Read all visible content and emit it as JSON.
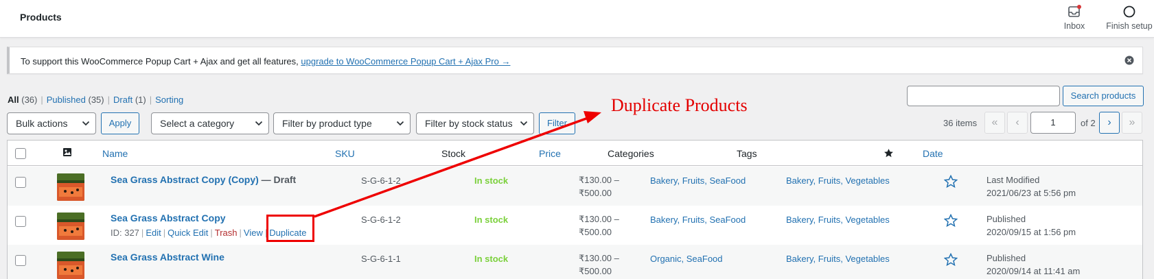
{
  "header": {
    "title": "Products",
    "inbox_label": "Inbox",
    "finish_label": "Finish setup"
  },
  "notice": {
    "text": "To support this WooCommerce Popup Cart + Ajax and get all features, ",
    "link": "upgrade to WooCommerce Popup Cart + Ajax Pro →"
  },
  "views": [
    {
      "label": "All",
      "count": "(36)"
    },
    {
      "label": "Published",
      "count": "(35)"
    },
    {
      "label": "Draft",
      "count": "(1)"
    },
    {
      "label": "Sorting",
      "count": ""
    }
  ],
  "search": {
    "button": "Search products",
    "value": ""
  },
  "filters": {
    "bulk": "Bulk actions",
    "apply": "Apply",
    "category": "Select a category",
    "type": "Filter by product type",
    "stock": "Filter by stock status",
    "filter": "Filter"
  },
  "pagination": {
    "items": "36 items",
    "first": "«",
    "prev": "‹",
    "current": "1",
    "of": "of 2",
    "next": "›",
    "last": "»"
  },
  "columns": {
    "name": "Name",
    "sku": "SKU",
    "stock": "Stock",
    "price": "Price",
    "categories": "Categories",
    "tags": "Tags",
    "date": "Date"
  },
  "rows": [
    {
      "name": "Sea Grass Abstract Copy (Copy)",
      "state": " — Draft",
      "sku": "S-G-6-1-2",
      "stock": "In stock",
      "price_low": "₹130.00 –",
      "price_high": "₹500.00",
      "categories": "Bakery, Fruits, SeaFood",
      "tags": "Bakery, Fruits, Vegetables",
      "date_status": "Last Modified",
      "date_value": "2021/06/23 at 5:56 pm"
    },
    {
      "name": "Sea Grass Abstract Copy",
      "state": "",
      "sku": "S-G-6-1-2",
      "stock": "In stock",
      "price_low": "₹130.00 –",
      "price_high": "₹500.00",
      "categories": "Bakery, Fruits, SeaFood",
      "tags": "Bakery, Fruits, Vegetables",
      "date_status": "Published",
      "date_value": "2020/09/15 at 1:56 pm",
      "actions": {
        "id": "ID: 327",
        "edit": "Edit",
        "quick_edit": "Quick Edit",
        "trash": "Trash",
        "view": "View",
        "duplicate": "Duplicate"
      }
    },
    {
      "name": "Sea Grass Abstract Wine",
      "state": "",
      "sku": "S-G-6-1-1",
      "stock": "In stock",
      "price_low": "₹130.00 –",
      "price_high": "₹500.00",
      "categories": "Organic, SeaFood",
      "tags": "Bakery, Fruits, Vegetables",
      "date_status": "Published",
      "date_value": "2020/09/14 at 11:41 am"
    }
  ],
  "annotation": {
    "label": "Duplicate Products"
  },
  "colors": {
    "link": "#2271b1",
    "in_stock": "#7ad03a",
    "trash": "#b32d2e",
    "annotation": "#e30000"
  }
}
